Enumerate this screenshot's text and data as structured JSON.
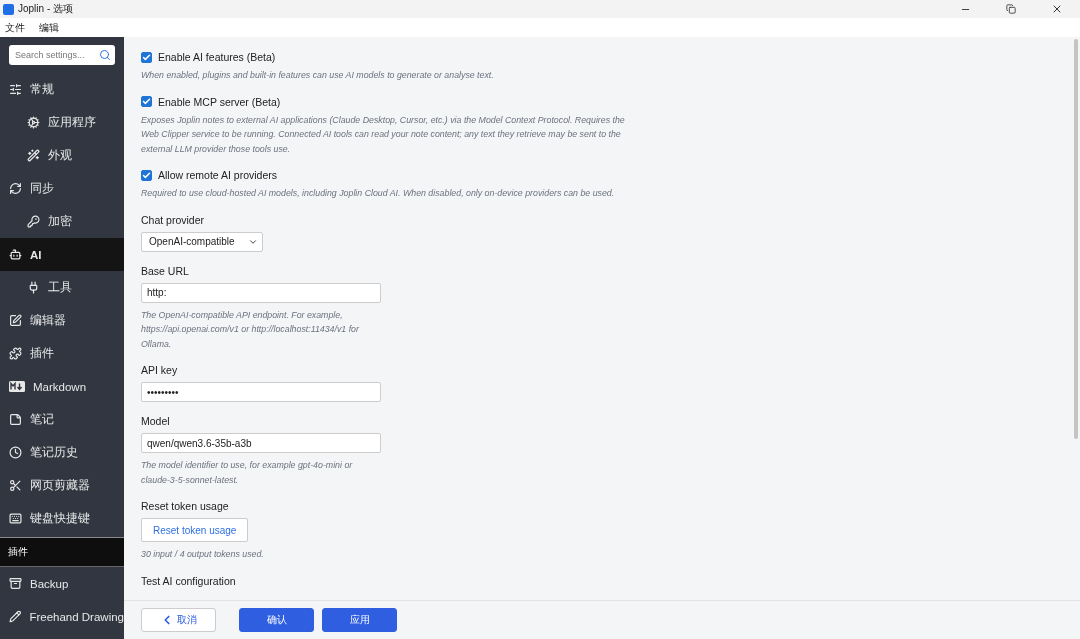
{
  "window": {
    "title": "Joplin - 选项"
  },
  "menu": [
    {
      "label": "文件"
    },
    {
      "label": "编辑"
    }
  ],
  "sidebar": {
    "search": {
      "placeholder": "Search settings..."
    },
    "items": [
      {
        "label": "常规",
        "selected": false,
        "children": [
          {
            "label": "应用程序",
            "selected": false
          },
          {
            "label": "外观",
            "selected": false
          }
        ]
      },
      {
        "label": "同步",
        "selected": false,
        "children": [
          {
            "label": "加密",
            "selected": false
          }
        ]
      },
      {
        "label": "AI",
        "selected": true,
        "children": [
          {
            "label": "工具",
            "selected": false
          }
        ]
      },
      {
        "label": "编辑器",
        "selected": false
      },
      {
        "label": "插件",
        "selected": false
      },
      {
        "label": "Markdown",
        "selected": false
      },
      {
        "label": "笔记",
        "selected": false
      },
      {
        "label": "笔记历史",
        "selected": false
      },
      {
        "label": "网页剪藏器",
        "selected": false
      },
      {
        "label": "键盘快捷键",
        "selected": false
      }
    ],
    "section": "插件",
    "plugin_items": [
      {
        "label": "Backup",
        "selected": false
      },
      {
        "label": "Freehand Drawing",
        "selected": false
      }
    ]
  },
  "settings": [
    {
      "kind": "checkbox",
      "label": "Enable AI features (Beta)",
      "checked": true,
      "description": "When enabled, plugins and built-in features can use AI models to generate or analyse text."
    },
    {
      "kind": "checkbox",
      "label": "Enable MCP server (Beta)",
      "checked": true,
      "description": "Exposes Joplin notes to external AI applications (Claude Desktop, Cursor, etc.) via the Model Context Protocol. Requires the Web Clipper service to be running. Connected AI tools can read your note content; any text they retrieve may be sent to the external LLM provider those tools use."
    },
    {
      "kind": "checkbox",
      "label": "Allow remote AI providers",
      "checked": true,
      "description": "Required to use cloud-hosted AI models, including Joplin Cloud AI. When disabled, only on-device providers can be used."
    },
    {
      "kind": "select",
      "label": "Chat provider",
      "value": "OpenAI-compatible"
    },
    {
      "kind": "text",
      "label": "Base URL",
      "value": "http:",
      "description": "The OpenAI-compatible API endpoint. For example, https://api.openai.com/v1 or http://localhost:11434/v1 for Ollama."
    },
    {
      "kind": "text",
      "label": "API key",
      "value": "•••••••••"
    },
    {
      "kind": "text",
      "label": "Model",
      "value": "qwen/qwen3.6-35b-a3b",
      "description": "The model identifier to use, for example gpt-4o-mini or claude-3-5-sonnet-latest."
    },
    {
      "kind": "button",
      "label": "Reset token usage",
      "button": "Reset token usage",
      "description": "30 input / 4 output tokens used."
    },
    {
      "kind": "heading",
      "label": "Test AI configuration"
    }
  ],
  "footer": [
    {
      "kind": "back",
      "label": "取消"
    },
    {
      "kind": "primary",
      "label": "确认"
    },
    {
      "kind": "primary",
      "label": "应用"
    }
  ]
}
